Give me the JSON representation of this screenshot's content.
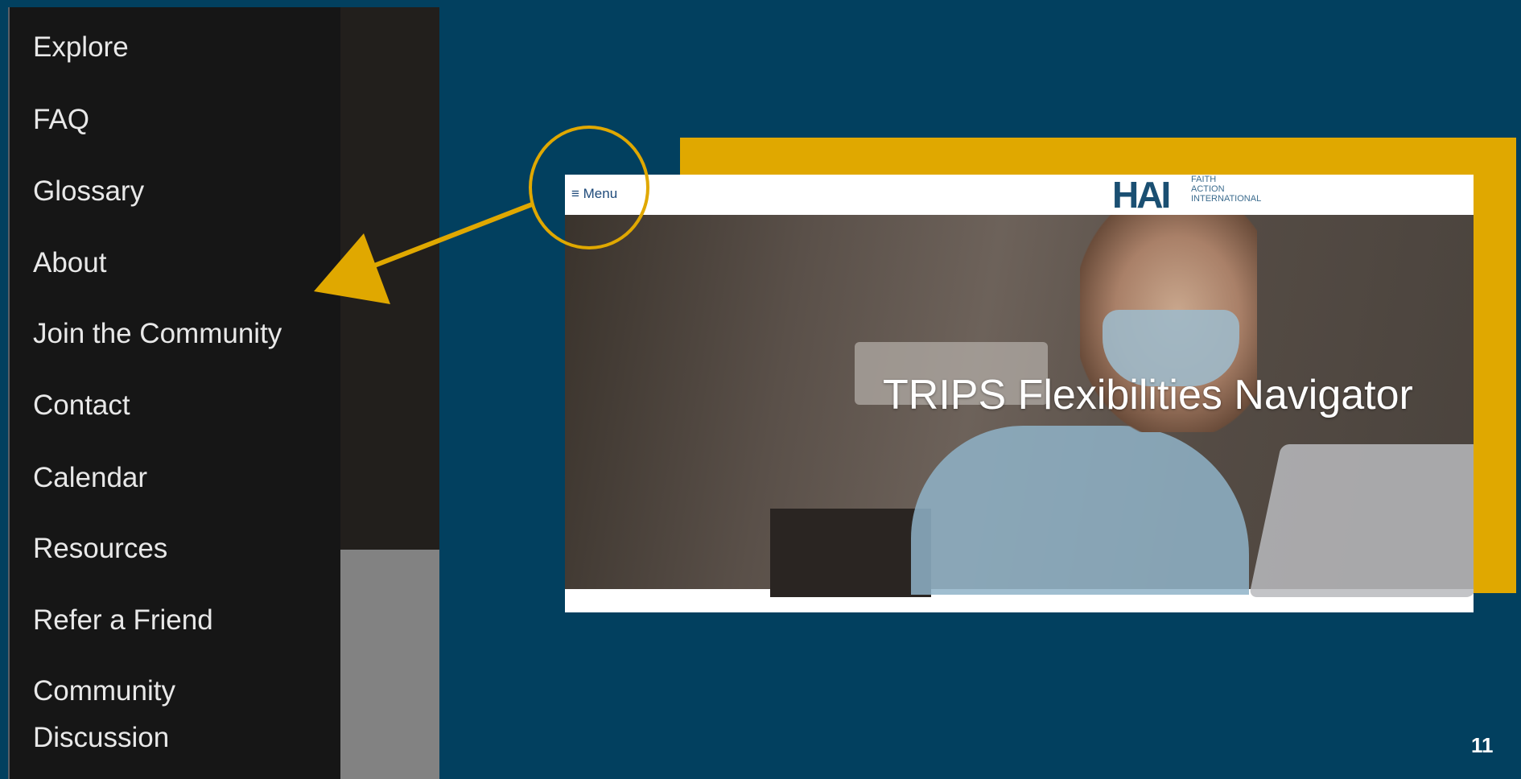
{
  "side_menu": {
    "items": [
      {
        "label": "Explore"
      },
      {
        "label": "FAQ"
      },
      {
        "label": "Glossary"
      },
      {
        "label": "About"
      },
      {
        "label": "Join the Community"
      },
      {
        "label": "Contact"
      },
      {
        "label": "Calendar"
      },
      {
        "label": "Resources"
      },
      {
        "label": "Refer a Friend"
      },
      {
        "label": "Community Discussion"
      }
    ]
  },
  "preview": {
    "menu_button": "≡ Menu",
    "logo": {
      "mark": "HAI",
      "wordmark": "FAITH\nACTION\nINTERNATIONAL"
    },
    "hero_title": "TRIPS Flexibilities Navigator"
  },
  "slide_number": "11",
  "colors": {
    "background": "#02405f",
    "accent": "#e0a800",
    "menu_bg": "#161616"
  }
}
